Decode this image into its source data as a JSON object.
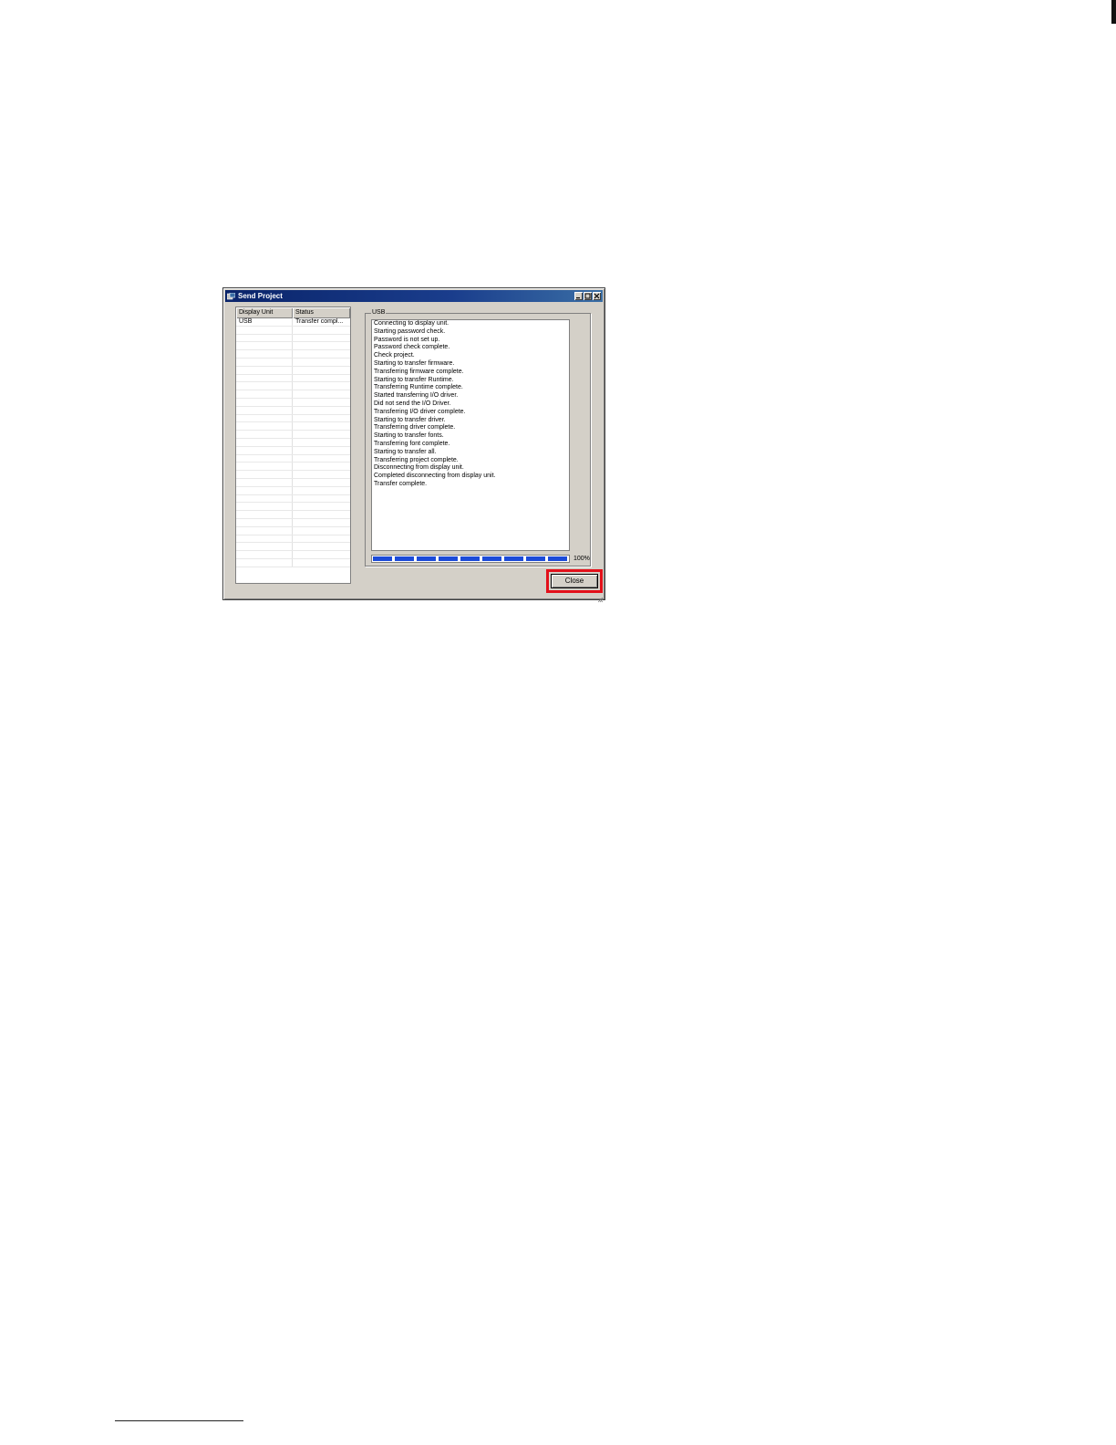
{
  "window": {
    "title": "Send Project",
    "icon": "app-icon",
    "controls": [
      "minimize-icon",
      "maximize-icon",
      "close-icon"
    ],
    "title_bar_color": "#0a246a"
  },
  "unit_list": {
    "headers": {
      "display_unit": "Display Unit",
      "status": "Status"
    },
    "rows": [
      {
        "display_unit": "USB",
        "status": "Transfer compl..."
      }
    ],
    "empty_row_count": 30
  },
  "log": {
    "group_label": "USB",
    "lines": [
      "Connecting to display unit.",
      "Starting password check.",
      "Password is not set up.",
      "Password check complete.",
      "Check project.",
      "Starting to transfer firmware.",
      "Transferring firmware complete.",
      "Starting to transfer Runtime.",
      "Transferring Runtime complete.",
      "Started transferring I/O driver.",
      "Did not send the I/O Driver.",
      "Transferring I/O driver complete.",
      "Starting to transfer driver.",
      "Transferring driver complete.",
      "Starting to transfer fonts.",
      "Transferring font complete.",
      "Starting to transfer all.",
      "Transferring project complete.",
      "Disconnecting from display unit.",
      "Completed disconnecting from display unit.",
      "Transfer complete."
    ]
  },
  "progress": {
    "percent_label": "100%",
    "value": 1.0,
    "color": "#1c4bd8"
  },
  "close_button": {
    "label": "Close",
    "highlight_color": "#e3101a"
  }
}
